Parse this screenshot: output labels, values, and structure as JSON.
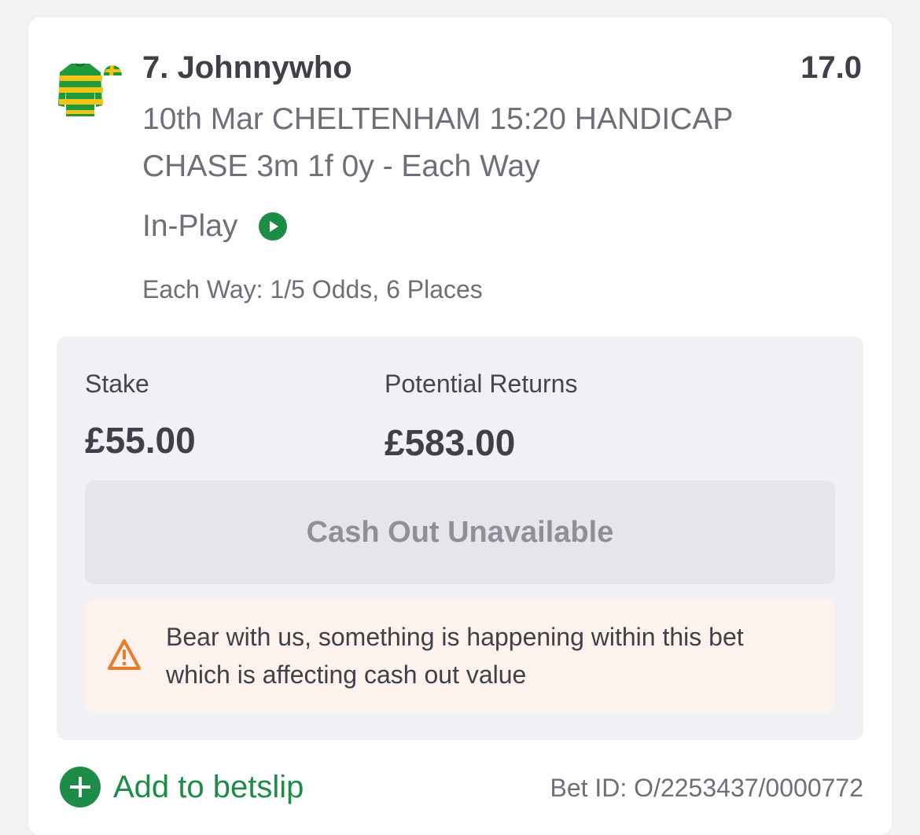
{
  "selection": {
    "title": "7. Johnnywho",
    "odds": "17.0",
    "event": "10th Mar CHELTENHAM 15:20 HANDICAP CHASE 3m 1f 0y - Each Way",
    "status": "In-Play",
    "each_way_terms": "Each Way: 1/5 Odds, 6 Places"
  },
  "bet": {
    "stake_label": "Stake",
    "stake_value": "£55.00",
    "returns_label": "Potential Returns",
    "returns_value": "£583.00",
    "cashout_label": "Cash Out Unavailable",
    "warning_text": "Bear with us, something is happening within this bet which is affecting cash out value",
    "add_betslip_label": "Add to betslip",
    "bet_id": "Bet ID: O/2253437/0000772"
  },
  "colors": {
    "accent_green": "#1c8c46",
    "warning_orange": "#ea7b2b",
    "silks_green": "#1f9a3a",
    "silks_yellow": "#f2c418"
  },
  "icons": {
    "silks": "jockey-silks-icon",
    "inplay": "play-icon",
    "warning": "warning-triangle-icon",
    "add": "plus-circle-icon"
  }
}
